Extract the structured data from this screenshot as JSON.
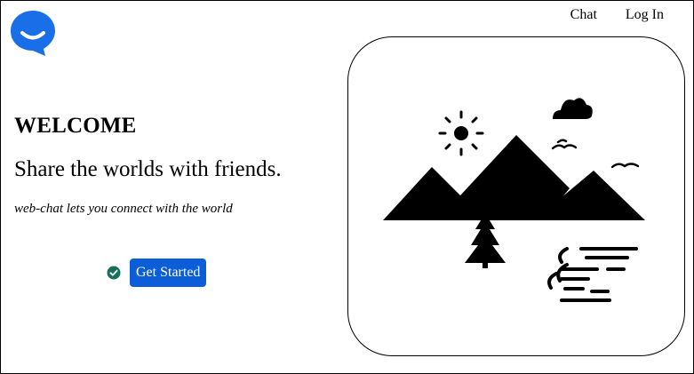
{
  "app": {
    "logo_icon": "chat-bubble-smile-icon",
    "brand_color": "#1a6ee8"
  },
  "nav": {
    "items": [
      {
        "label": "Chat"
      },
      {
        "label": "Log In"
      }
    ]
  },
  "hero": {
    "title": "WELCOME",
    "subtitle": "Share the worlds with friends.",
    "tagline": "web-chat lets you connect with the world",
    "cta_label": "Get Started",
    "cta_color": "#0b5ed7",
    "cta_status_icon": "check-circle-icon",
    "cta_status_color": "#16705b"
  },
  "illustration": {
    "icon": "landscape-mountains-icon",
    "elements": [
      "sun-icon",
      "cloud-icon",
      "birds-icon",
      "mountains-icon",
      "pine-tree-icon",
      "wind-icon"
    ]
  }
}
